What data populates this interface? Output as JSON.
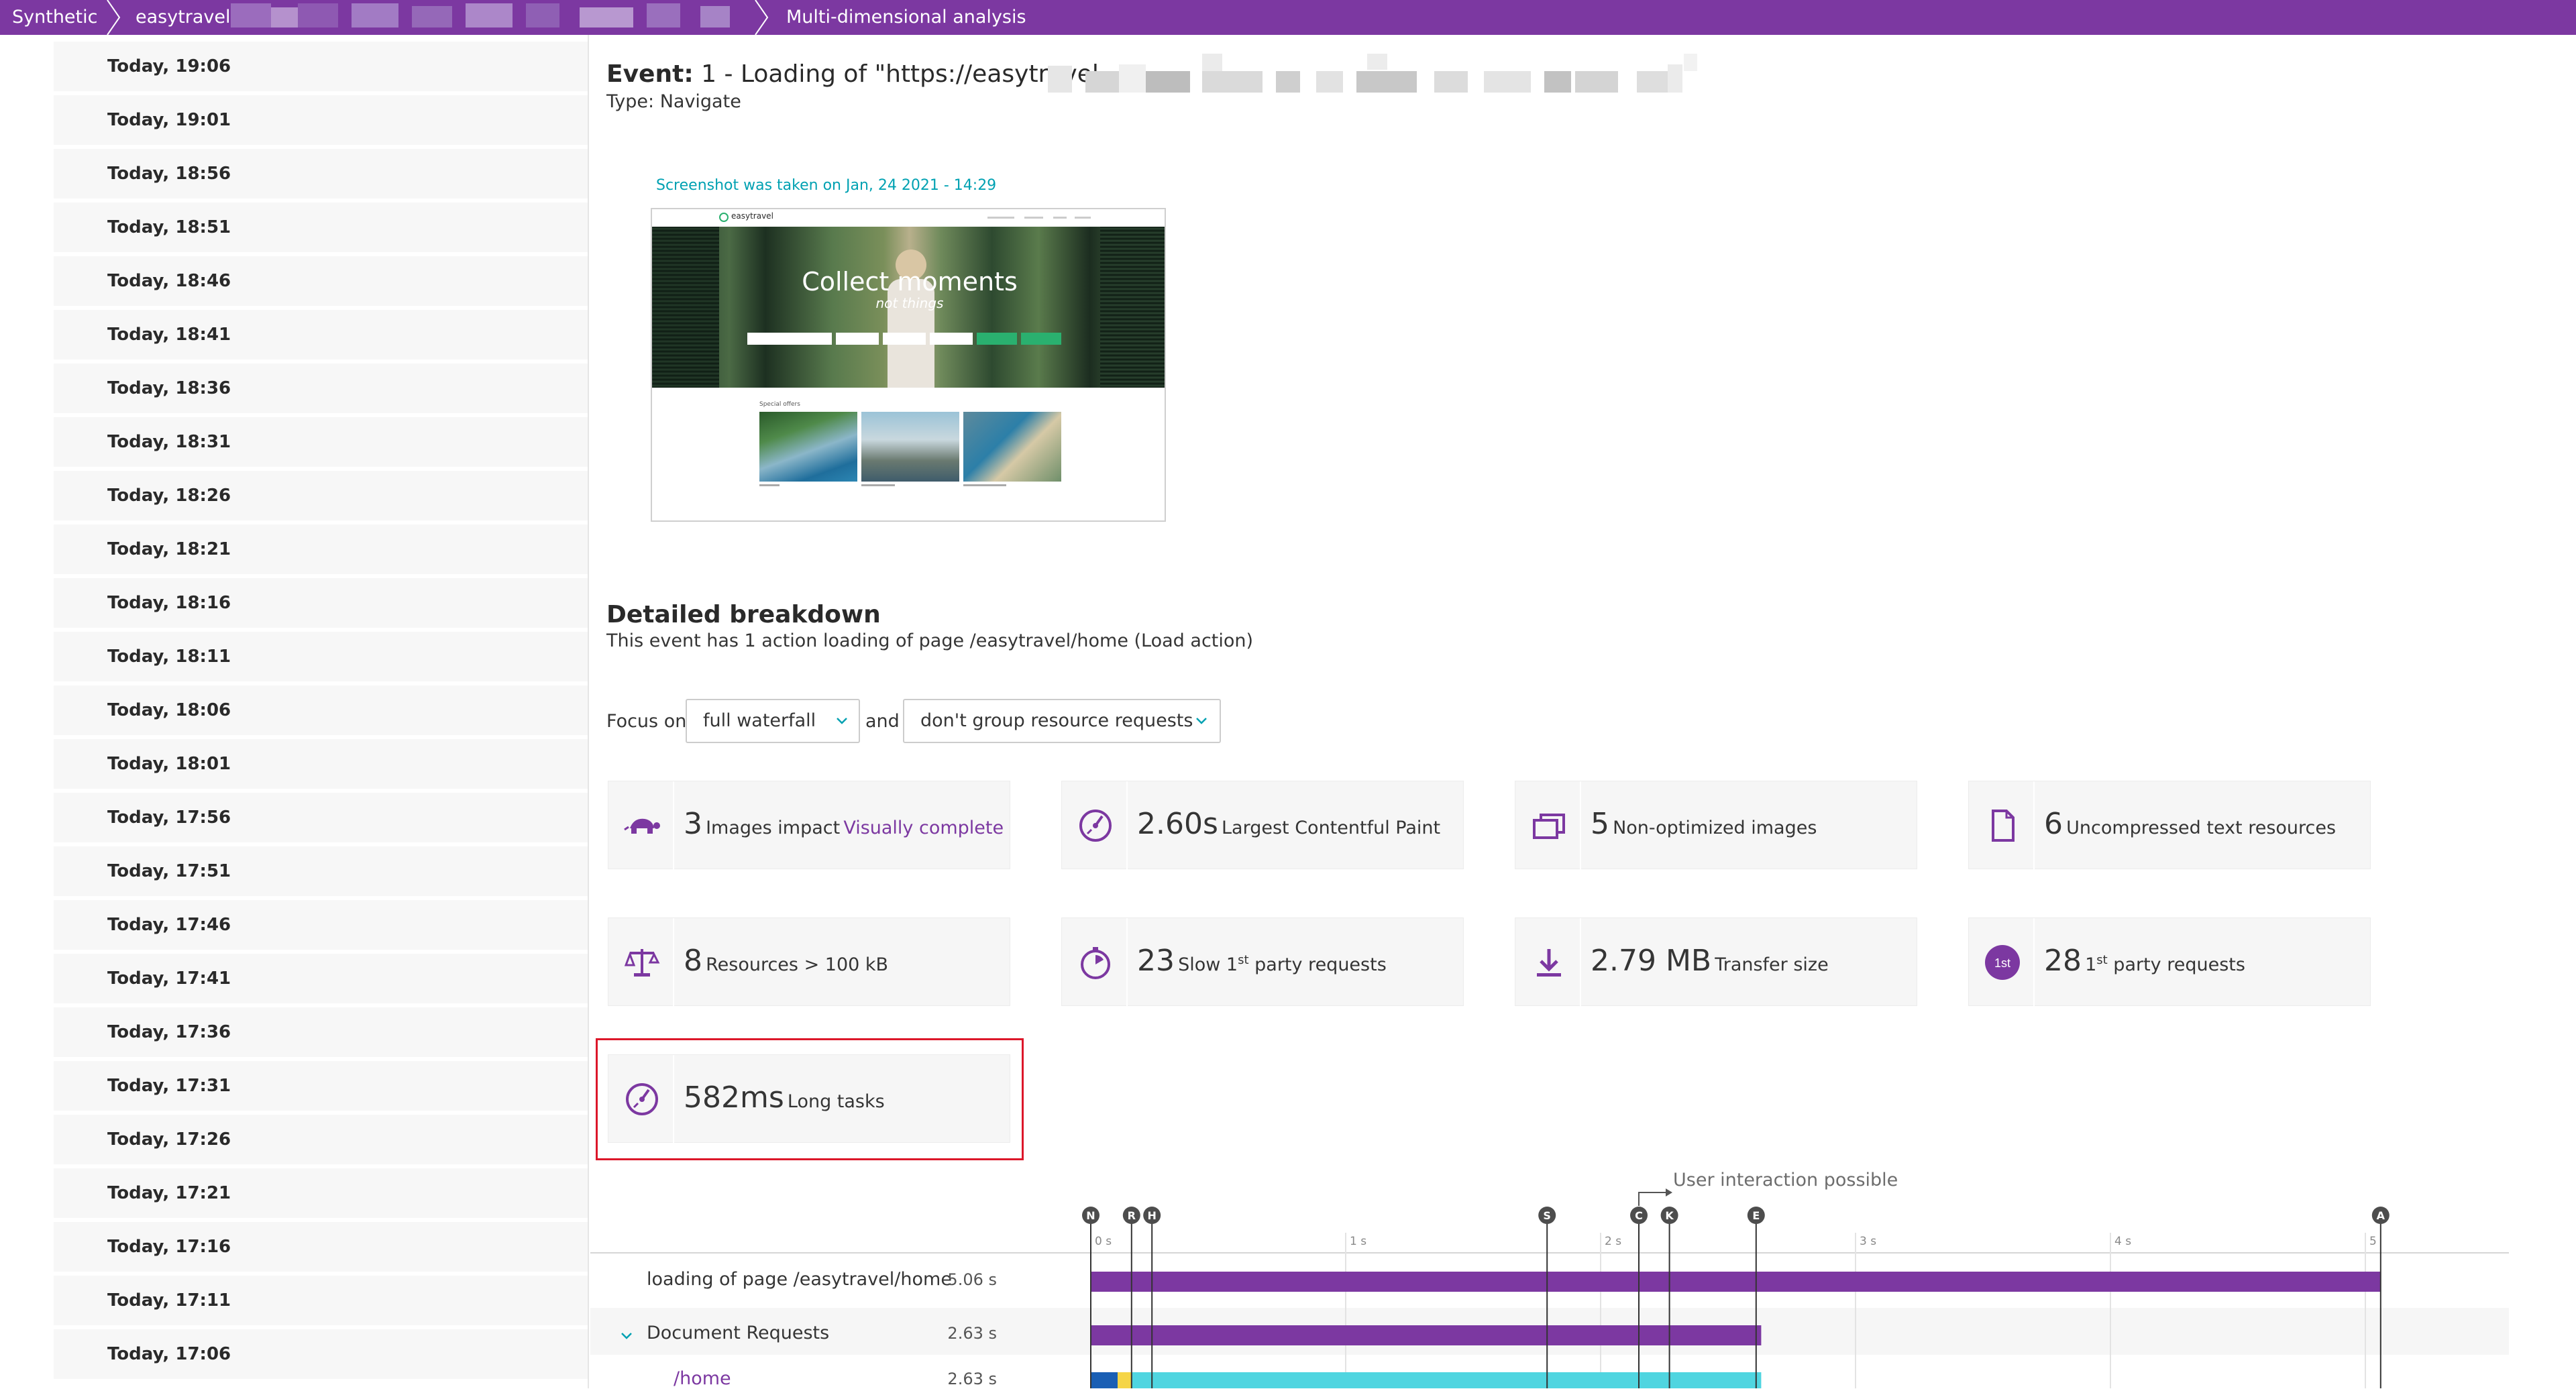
{
  "breadcrumb": {
    "items": [
      "Synthetic",
      "easytravel-",
      "Multi-dimensional analysis"
    ]
  },
  "runs": [
    "Today, 19:06",
    "Today, 19:01",
    "Today, 18:56",
    "Today, 18:51",
    "Today, 18:46",
    "Today, 18:41",
    "Today, 18:36",
    "Today, 18:31",
    "Today, 18:26",
    "Today, 18:21",
    "Today, 18:16",
    "Today, 18:11",
    "Today, 18:06",
    "Today, 18:01",
    "Today, 17:56",
    "Today, 17:51",
    "Today, 17:46",
    "Today, 17:41",
    "Today, 17:36",
    "Today, 17:31",
    "Today, 17:26",
    "Today, 17:21",
    "Today, 17:16",
    "Today, 17:11",
    "Today, 17:06"
  ],
  "event": {
    "label": "Event:",
    "title": "1 - Loading of \"https://easytravel-",
    "type": "Type: Navigate"
  },
  "screenshot": {
    "caption": "Screenshot was taken on Jan, 24 2021 - 14:29",
    "brand": "easytravel",
    "headline": "Collect moments",
    "subheadline": "not things",
    "section": "Special offers"
  },
  "breakdown": {
    "title": "Detailed breakdown",
    "subtitle": "This event has 1 action loading of page /easytravel/home (Load action)",
    "focus_label": "Focus on",
    "focus_value": "full waterfall",
    "and_label": "and",
    "group_value": "don't group resource requests"
  },
  "cards": [
    {
      "value": "3",
      "label": "Images impact",
      "link": "Visually complete",
      "icon": "turtle-icon"
    },
    {
      "value": "2.60s",
      "label": "Largest Contentful Paint",
      "icon": "speedometer-icon"
    },
    {
      "value": "5",
      "label": "Non-optimized images",
      "icon": "images-icon"
    },
    {
      "value": "6",
      "label": "Uncompressed text resources",
      "icon": "document-icon"
    },
    {
      "value": "8",
      "label": "Resources > 100 kB",
      "icon": "scale-icon"
    },
    {
      "value": "23",
      "label_pre": "Slow 1",
      "label_sup": "st",
      "label_post": " party requests",
      "icon": "stopwatch-icon"
    },
    {
      "value": "2.79 MB",
      "label": "Transfer size",
      "icon": "download-icon"
    },
    {
      "value": "28",
      "label_pre": "1",
      "label_sup": "st",
      "label_post": " party requests",
      "icon": "first-party-icon",
      "icon_text": "1st"
    },
    {
      "value": "582ms",
      "label": "Long tasks",
      "icon": "speedometer-icon"
    }
  ],
  "waterfall": {
    "user_interaction": "User interaction possible",
    "markers": [
      "N",
      "R",
      "H",
      "S",
      "C",
      "K",
      "E",
      "A"
    ],
    "ticks": [
      "0 s",
      "1 s",
      "2 s",
      "3 s",
      "4 s",
      "5"
    ],
    "rows": [
      {
        "label": "loading of page /easytravel/home",
        "duration": "5.06 s",
        "bar_start": 0,
        "bar_end": 5.06
      },
      {
        "label": "Document Requests",
        "duration": "2.63 s",
        "bar_start": 0,
        "bar_end": 2.63
      },
      {
        "label": "/home",
        "duration": "2.63 s",
        "bar_start": 0,
        "bar_end": 2.63
      }
    ]
  },
  "colors": {
    "brand": "#7c38a1",
    "accent_teal": "#00a1b2",
    "bar_request": "#4fd5e0",
    "highlight": "#dc172a"
  }
}
